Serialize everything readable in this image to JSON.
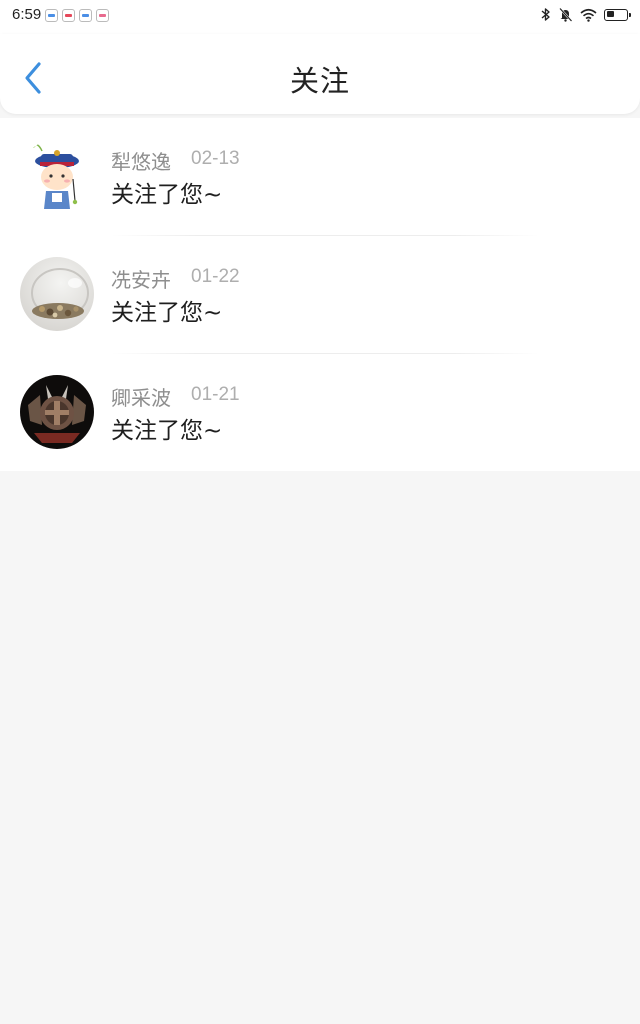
{
  "status_bar": {
    "time": "6:59",
    "notification_icons": [
      "app-notification-icon",
      "app-notification-icon",
      "app-notification-icon",
      "app-notification-icon"
    ],
    "system_icons": [
      "bluetooth-icon",
      "mute-icon",
      "wifi-icon",
      "battery-icon"
    ]
  },
  "header": {
    "title": "关注",
    "back_icon": "chevron-left-icon",
    "accent_color": "#3d8fde"
  },
  "items": [
    {
      "name": "犁悠逸",
      "date": "02-13",
      "message": "关注了您~",
      "avatar": "cartoon-character-avatar"
    },
    {
      "name": "冼安卉",
      "date": "01-22",
      "message": "关注了您~",
      "avatar": "glass-jar-photo-avatar"
    },
    {
      "name": "卿采波",
      "date": "01-21",
      "message": "关注了您~",
      "avatar": "dark-emblem-avatar"
    }
  ]
}
